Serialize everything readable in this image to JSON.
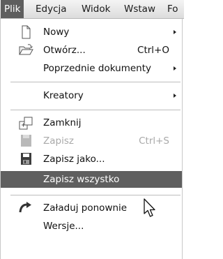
{
  "menubar": {
    "items": [
      {
        "label": "Plik",
        "active": true
      },
      {
        "label": "Edycja"
      },
      {
        "label": "Widok"
      },
      {
        "label": "Wstaw"
      },
      {
        "label": "Fo"
      }
    ]
  },
  "menu": {
    "items": [
      {
        "label": "Nowy",
        "icon": "new-document-icon",
        "submenu": true
      },
      {
        "label": "Otwórz...",
        "shortcut": "Ctrl+O",
        "icon": "open-folder-icon"
      },
      {
        "label": "Poprzednie dokumenty",
        "submenu": true
      },
      {
        "label": "Kreatory",
        "submenu": true
      },
      {
        "label": "Zamknij",
        "icon": "close-document-icon"
      },
      {
        "label": "Zapisz",
        "shortcut": "Ctrl+S",
        "icon": "save-icon",
        "disabled": true
      },
      {
        "label": "Zapisz jako...",
        "icon": "save-as-icon"
      },
      {
        "label": "Zapisz wszystko",
        "highlighted": true
      },
      {
        "label": "Załaduj ponownie",
        "icon": "reload-icon"
      },
      {
        "label": "Wersje..."
      }
    ]
  },
  "colors": {
    "highlight": "#5f5f5f",
    "disabled_text": "#a9a9a9",
    "menubar_bg": "#e6e6e6"
  }
}
